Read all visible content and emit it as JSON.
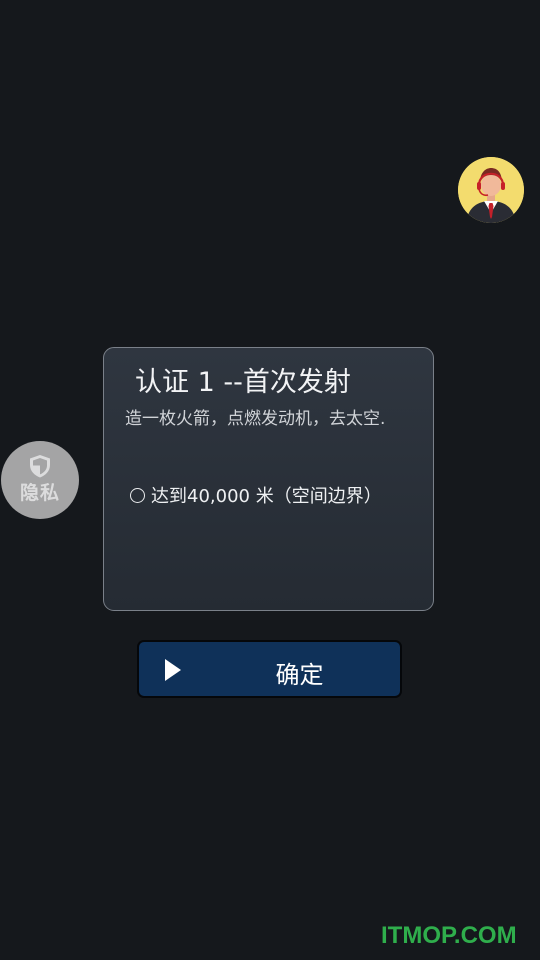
{
  "avatar": {
    "icon": "customer-service-agent-icon",
    "background_color": "#f3dc6e"
  },
  "privacy": {
    "icon": "shield-icon",
    "label": "隐私"
  },
  "dialog": {
    "title": "认证 1 --首次发射",
    "subtitle": "造一枚火箭，点燃发动机，去太空.",
    "objectives": [
      {
        "status": "incomplete",
        "text": "达到40,000 米（空间边界）"
      }
    ]
  },
  "confirm": {
    "icon": "play-icon",
    "label": "确定",
    "color": "#0f3159"
  },
  "watermark": {
    "text": "ITMOP.COM",
    "color": "#2fae4c"
  },
  "colors": {
    "background": "#15181c",
    "dialog_background": "#2b323b",
    "dialog_border": "#7a8089"
  }
}
